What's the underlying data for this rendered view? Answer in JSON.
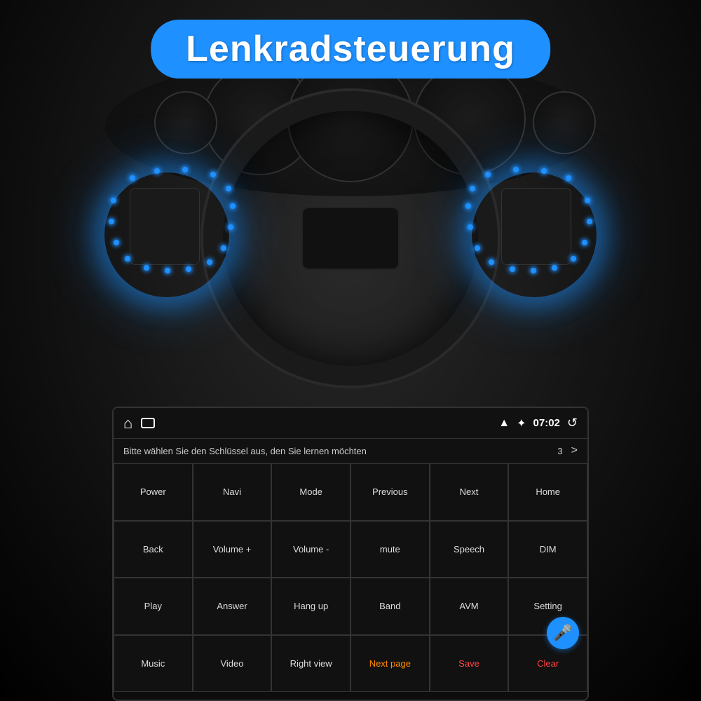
{
  "title": "Lenkradsteuerung",
  "statusBar": {
    "time": "07:02",
    "icons": [
      "home",
      "window",
      "wifi",
      "bluetooth",
      "refresh"
    ]
  },
  "instruction": {
    "text": "Bitte wählen Sie den Schlüssel aus, den Sie lernen möchten",
    "count": "3",
    "arrow": ">"
  },
  "grid": {
    "rows": [
      [
        {
          "label": "Power",
          "style": "normal"
        },
        {
          "label": "Navi",
          "style": "normal"
        },
        {
          "label": "Mode",
          "style": "normal"
        },
        {
          "label": "Previous",
          "style": "normal"
        },
        {
          "label": "Next",
          "style": "normal"
        },
        {
          "label": "Home",
          "style": "normal"
        }
      ],
      [
        {
          "label": "Back",
          "style": "normal"
        },
        {
          "label": "Volume +",
          "style": "normal"
        },
        {
          "label": "Volume -",
          "style": "normal"
        },
        {
          "label": "mute",
          "style": "normal"
        },
        {
          "label": "Speech",
          "style": "normal"
        },
        {
          "label": "DIM",
          "style": "normal"
        }
      ],
      [
        {
          "label": "Play",
          "style": "normal"
        },
        {
          "label": "Answer",
          "style": "normal"
        },
        {
          "label": "Hang up",
          "style": "normal"
        },
        {
          "label": "Band",
          "style": "normal"
        },
        {
          "label": "AVM",
          "style": "normal"
        },
        {
          "label": "Setting",
          "style": "normal"
        }
      ],
      [
        {
          "label": "Music",
          "style": "normal"
        },
        {
          "label": "Video",
          "style": "normal"
        },
        {
          "label": "Right view",
          "style": "normal"
        },
        {
          "label": "Next page",
          "style": "orange"
        },
        {
          "label": "Save",
          "style": "red"
        },
        {
          "label": "Clear",
          "style": "red"
        }
      ]
    ]
  },
  "micButton": "🎤"
}
